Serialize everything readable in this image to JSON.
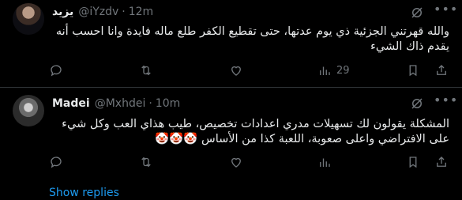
{
  "tweets": [
    {
      "name": "يزيد",
      "handle": "@iYzdv",
      "separator": "·",
      "time": "12m",
      "text": "والله قهرتني الجزئية ذي يوم عدتها، حتى تقطيع الكفر طلع ماله فايدة وانا احسب أنه يقدم ذاك الشيء",
      "views": "29"
    },
    {
      "name": "Madei",
      "handle": "@Mxhdei",
      "separator": "·",
      "time": "10m",
      "text": "المشكلة يقولون لك تسهيلات مدري اعدادات تخصيص، طيب هذاي العب وكل شيء على الافتراضي واعلى صعوبة، اللعبة كذا من الأساس 🤡🤡🤡",
      "views": ""
    }
  ],
  "show_replies": "Show replies",
  "icons": {
    "grok": "grok-icon",
    "more": "more-icon",
    "reply": "reply-icon",
    "retweet": "retweet-icon",
    "like": "like-icon",
    "views": "views-icon",
    "bookmark": "bookmark-icon",
    "share": "share-icon"
  },
  "colors": {
    "background": "#000000",
    "text": "#e7e9ea",
    "secondary": "#71767b",
    "link": "#1d9bf0",
    "divider": "#2f3336"
  }
}
